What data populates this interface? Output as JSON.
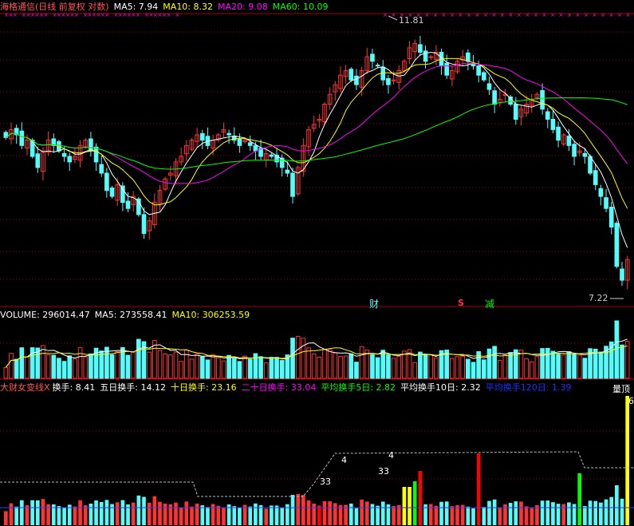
{
  "colors": {
    "up": "#ff3333",
    "down": "#54fcfc",
    "ma5": "#ffffff",
    "ma10": "#ffff00",
    "ma20": "#ff00ff",
    "ma60": "#00ff00",
    "grid": "#8b0000",
    "axis": "#b00000"
  },
  "header_price": {
    "title": "海格通信(日线 前复权 对数)",
    "ma5": "MA5: 7.94",
    "ma10": "MA10: 8.32",
    "ma20": "MA20: 9.08",
    "ma60": "MA60: 10.09"
  },
  "header_volume": {
    "label": "VOLUME: 296014.47",
    "ma5": "MA5: 273558.41",
    "ma10": "MA10: 306253.59"
  },
  "header_turnover": {
    "name": "大财女变线X",
    "t1": "换手: 8.41",
    "t2": "五日换手: 14.12",
    "t3": "十日换手: 23.16",
    "t4": "二十日换手: 33.04",
    "t5": "平均换手5日: 2.82",
    "t6": "平均换手10日: 2.32",
    "t7": "平均换手120日: 1.39",
    "right": "量顶"
  },
  "annotations": {
    "high": "11.81",
    "low": "7.22",
    "cai": "财",
    "s": "S",
    "jian": "减",
    "n4a": "4",
    "n33a": "33",
    "n4b": "4",
    "n33b": "33",
    "n6": "6"
  },
  "chart_data": [
    {
      "type": "candlestick",
      "title": "海格通信(日线 前复权 对数)",
      "high_label": 11.81,
      "low_label": 7.22,
      "series": [
        {
          "name": "MA5",
          "last": 7.94
        },
        {
          "name": "MA10",
          "last": 8.32
        },
        {
          "name": "MA20",
          "last": 9.08
        },
        {
          "name": "MA60",
          "last": 10.09
        }
      ],
      "close": [
        9.65,
        9.8,
        9.7,
        9.5,
        9.6,
        9.3,
        9.1,
        9.4,
        9.6,
        9.5,
        9.4,
        9.3,
        9.2,
        9.3,
        9.5,
        9.6,
        9.4,
        9.2,
        9.0,
        8.7,
        8.6,
        8.8,
        8.5,
        8.4,
        8.6,
        8.3,
        8.0,
        8.2,
        8.5,
        8.7,
        8.9,
        9.0,
        9.2,
        9.3,
        9.5,
        9.6,
        9.7,
        9.6,
        9.5,
        9.6,
        9.7,
        9.8,
        9.7,
        9.6,
        9.5,
        9.6,
        9.5,
        9.4,
        9.3,
        9.35,
        9.3,
        9.2,
        9.1,
        9.0,
        8.6,
        9.1,
        9.5,
        9.8,
        9.9,
        10.0,
        10.3,
        10.5,
        10.7,
        10.9,
        11.0,
        10.8,
        10.7,
        11.0,
        11.3,
        11.2,
        11.1,
        10.8,
        10.7,
        10.8,
        11.0,
        11.2,
        11.5,
        11.6,
        11.4,
        11.2,
        11.3,
        11.4,
        11.1,
        10.9,
        11.0,
        11.2,
        11.3,
        11.2,
        11.1,
        10.9,
        10.8,
        10.6,
        10.3,
        10.4,
        10.5,
        10.3,
        10.0,
        10.2,
        10.3,
        10.4,
        10.5,
        10.2,
        10.0,
        9.8,
        9.6,
        9.7,
        9.5,
        9.3,
        9.4,
        9.3,
        9.0,
        8.8,
        8.6,
        8.4,
        8.1,
        7.5,
        7.3,
        7.6
      ],
      "volume_ma": {
        "MA5": 273558.41,
        "MA10": 306253.59
      },
      "turnover": {
        "换手": 8.41,
        "五日换手": 14.12,
        "十日换手": 23.16,
        "二十日换手": 33.04,
        "平均换手5日": 2.82,
        "平均换手10日": 2.32,
        "平均换手120日": 1.39
      }
    }
  ]
}
